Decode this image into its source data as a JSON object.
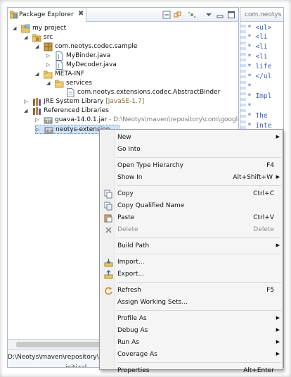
{
  "explorer": {
    "tab_title": "Package Explorer",
    "close_glyph": "✖",
    "toolbar_icons": [
      "collapse-all-icon",
      "link-with-editor-icon",
      "focus-icon",
      "view-menu-icon",
      "minimize-icon",
      "maximize-icon"
    ]
  },
  "tree": [
    {
      "label": "my project",
      "icon": "project-icon",
      "twisty": "◢"
    },
    {
      "label": "src",
      "icon": "source-folder-icon",
      "twisty": "◢"
    },
    {
      "label": "com.neotys.codec.sample",
      "icon": "package-icon",
      "twisty": "◢"
    },
    {
      "label": "MyBinder.java",
      "icon": "java-file-icon",
      "twisty": "▷"
    },
    {
      "label": "MyDecoder.java",
      "icon": "java-file-icon",
      "twisty": "▷"
    },
    {
      "label": "META-INF",
      "icon": "folder-icon",
      "twisty": "◢"
    },
    {
      "label": "services",
      "icon": "folder-icon",
      "twisty": "◢"
    },
    {
      "label": "com.neotys.extensions.codec.AbstractBinder",
      "icon": "file-icon",
      "twisty": ""
    },
    {
      "label": "JRE System Library",
      "decor": " [JavaSE-1.7]",
      "icon": "library-icon",
      "twisty": "▷"
    },
    {
      "label": "Referenced Libraries",
      "icon": "library-icon",
      "twisty": "◢"
    },
    {
      "label": "guava-14.0.1.jar",
      "decor": " - D:\\Neotys\\maven\\repository\\com\\google\\gua",
      "icon": "jar-icon",
      "twisty": "▷"
    },
    {
      "label": "neotys-extension",
      "icon": "jar-icon",
      "twisty": "▷"
    }
  ],
  "status": {
    "text": "D:\\Neotys\\maven\\repository\\com",
    "under": "initiaal"
  },
  "editor": {
    "tab_label": "com.neotys",
    "lines": [
      "* <ul>",
      "* <li",
      "* <li",
      "* <li",
      "* life",
      "* </ul",
      "*",
      "* Impl",
      "*",
      "* The",
      "* inte",
      "*"
    ]
  },
  "menu": {
    "items": [
      {
        "label": "New",
        "submenu": true
      },
      {
        "label": "Go Into"
      },
      {
        "sep": true
      },
      {
        "label": "Open Type Hierarchy",
        "shortcut": "F4"
      },
      {
        "label": "Show In",
        "shortcut": "Alt+Shift+W",
        "submenu": true
      },
      {
        "sep": true
      },
      {
        "label": "Copy",
        "shortcut": "Ctrl+C",
        "icon": "copy-icon"
      },
      {
        "label": "Copy Qualified Name",
        "icon": "copy-qualified-name-icon"
      },
      {
        "label": "Paste",
        "shortcut": "Ctrl+V",
        "icon": "paste-icon"
      },
      {
        "label": "Delete",
        "shortcut": "Delete",
        "icon": "delete-icon",
        "disabled": true
      },
      {
        "sep": true
      },
      {
        "label": "Build Path",
        "submenu": true
      },
      {
        "sep": true
      },
      {
        "label": "Import...",
        "icon": "import-icon"
      },
      {
        "label": "Export...",
        "icon": "export-icon"
      },
      {
        "sep": true
      },
      {
        "label": "Refresh",
        "shortcut": "F5",
        "icon": "refresh-icon"
      },
      {
        "label": "Assign Working Sets..."
      },
      {
        "sep": true
      },
      {
        "label": "Profile As",
        "submenu": true
      },
      {
        "label": "Debug As",
        "submenu": true
      },
      {
        "label": "Run As",
        "submenu": true
      },
      {
        "label": "Coverage As",
        "submenu": true
      },
      {
        "sep": true
      },
      {
        "label": "Properties",
        "shortcut": "Alt+Enter"
      }
    ],
    "submenu_glyph": "▶"
  },
  "colors": {
    "java_blue": "#3f5fbf",
    "selection": "#cfe3fb",
    "menu_bg": "#f5f5f5"
  }
}
